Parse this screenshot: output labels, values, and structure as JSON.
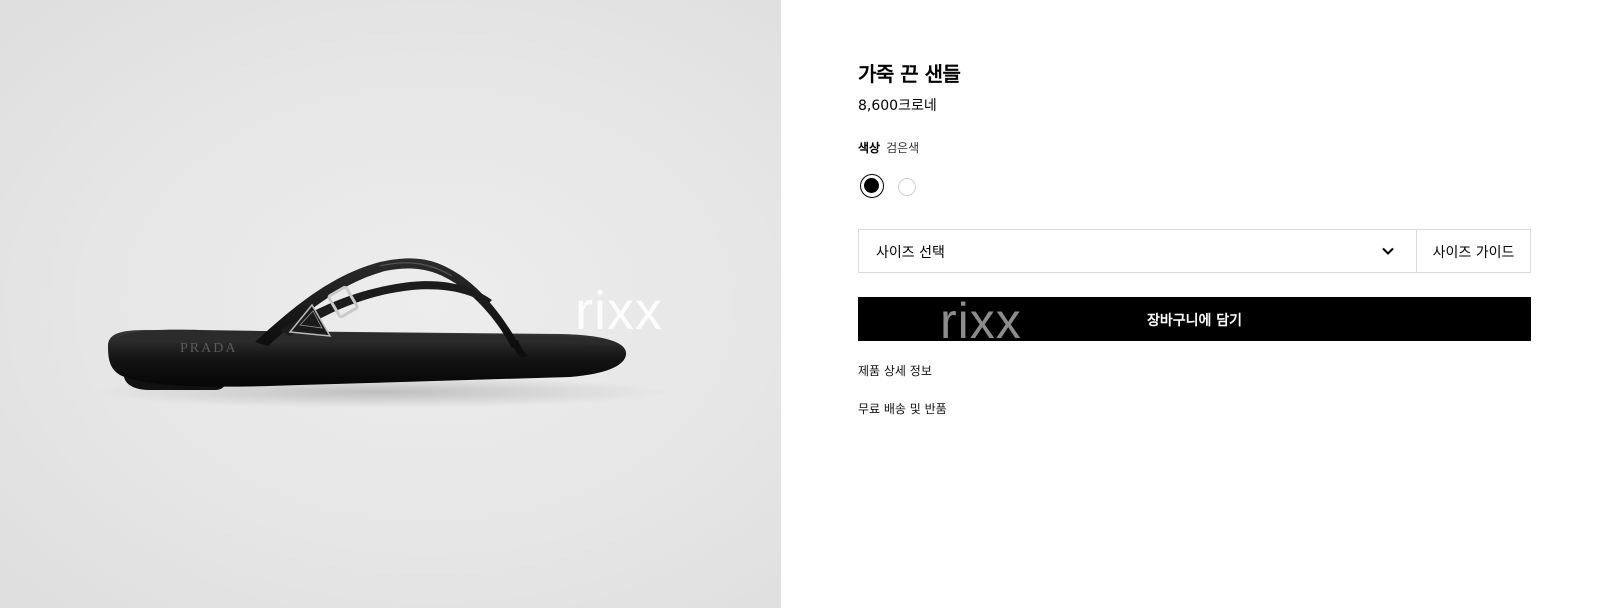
{
  "product": {
    "title": "가죽 끈 샌들",
    "price": "8,600크로네",
    "image_brand_text": "PRADA"
  },
  "color": {
    "label": "색상",
    "selected": "검은색",
    "swatches": [
      {
        "name": "black",
        "hex": "#000000",
        "selected": true
      },
      {
        "name": "white",
        "hex": "#ffffff",
        "selected": false
      }
    ]
  },
  "size": {
    "select_label": "사이즈 선택",
    "guide_label": "사이즈 가이드",
    "chevron_icon": "chevron-down-icon"
  },
  "cart": {
    "button_label": "장바구니에 담기",
    "button_color": "#000000"
  },
  "links": {
    "details": "제품 상세 정보",
    "shipping": "무료 배송 및 반품"
  },
  "watermark": {
    "image_text": "rixx",
    "button_text": "rixx"
  }
}
